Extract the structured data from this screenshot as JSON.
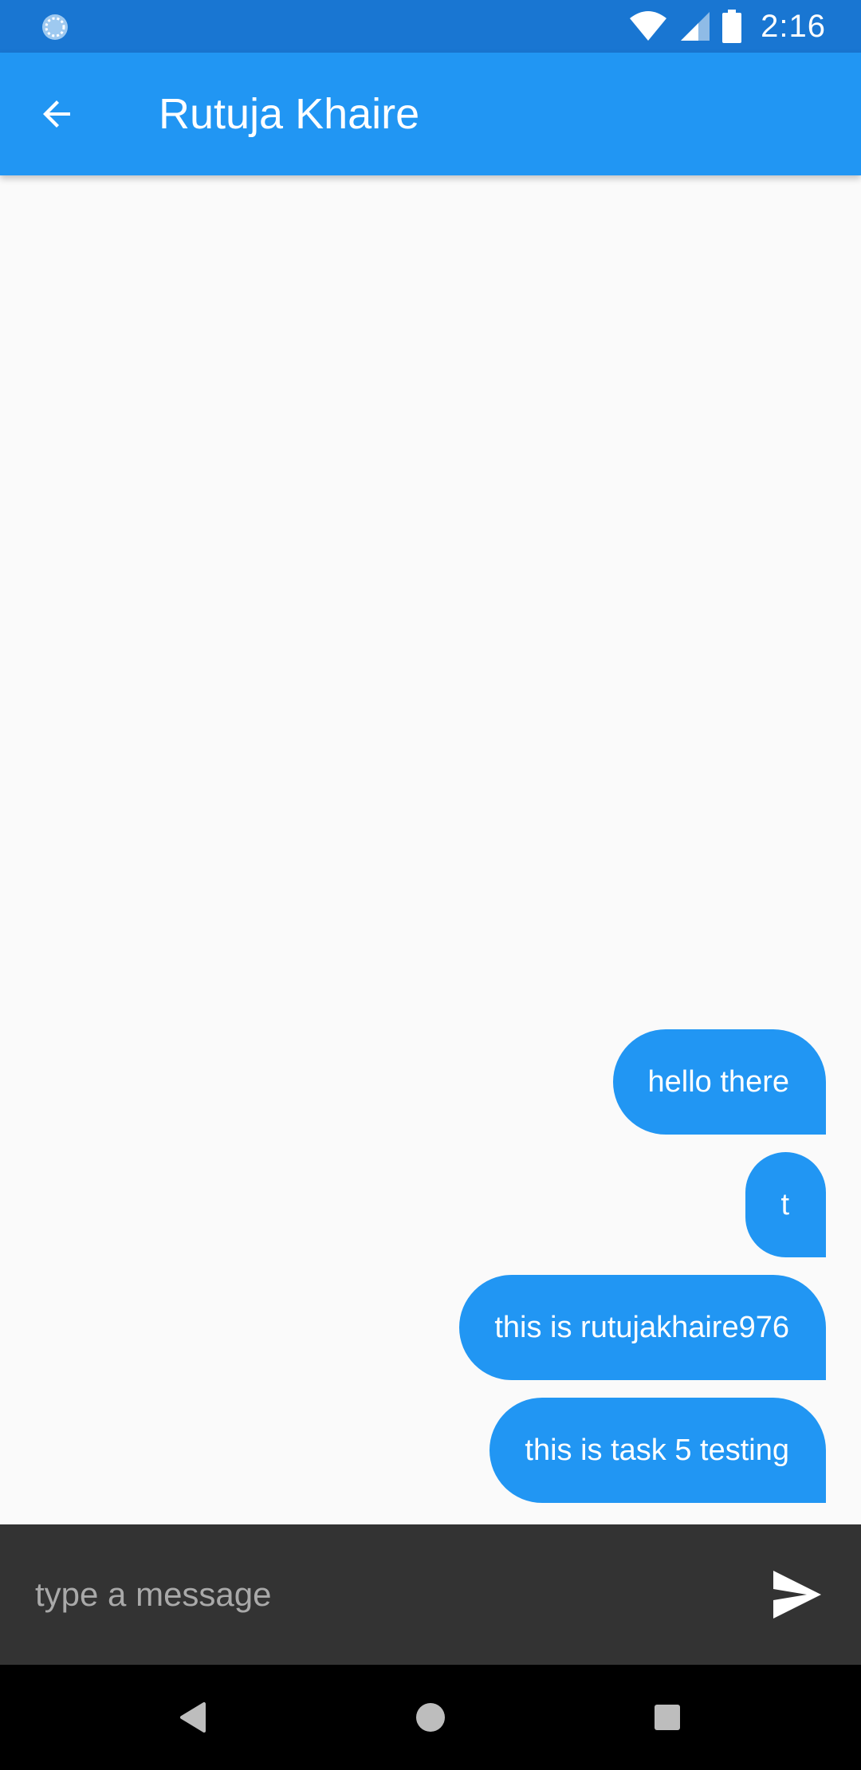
{
  "status_bar": {
    "time": "2:16",
    "icons": [
      "sync-icon",
      "wifi-icon",
      "cell-signal-icon",
      "battery-icon"
    ]
  },
  "app_bar": {
    "title": "Rutuja Khaire",
    "back_icon": "arrow-back-icon"
  },
  "messages": [
    {
      "text": "hello there",
      "sender": "me"
    },
    {
      "text": "t",
      "sender": "me"
    },
    {
      "text": "this is rutujakhaire976",
      "sender": "me"
    },
    {
      "text": "this is task 5 testing",
      "sender": "me"
    }
  ],
  "composer": {
    "placeholder": "type a message",
    "value": "",
    "send_icon": "send-icon"
  },
  "nav_bar": {
    "buttons": [
      "back-triangle-icon",
      "home-circle-icon",
      "recents-square-icon"
    ]
  },
  "colors": {
    "status_bar": "#1976d2",
    "app_bar": "#2196f3",
    "bubble": "#2196f3",
    "background": "#fafafa",
    "composer": "#333333",
    "nav_bar": "#000000"
  }
}
